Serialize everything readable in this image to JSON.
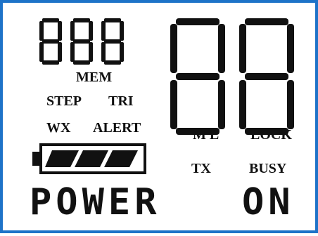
{
  "display": {
    "top_left_digits": "888",
    "big_digits": "88",
    "colors": {
      "frame": "#1e73c8",
      "segments": "#111111",
      "background": "#ffffff"
    }
  },
  "indicators": {
    "mem": "MEM",
    "step": "STEP",
    "tri": "TRI",
    "wx": "WX",
    "alert": "ALERT",
    "ml": "M L",
    "lock": "LOCK",
    "tx": "TX",
    "busy": "BUSY"
  },
  "battery": {
    "icon": "battery-icon",
    "level": 1.0,
    "bars": 3
  },
  "status_line": {
    "left": "POWER",
    "right": "ON"
  }
}
